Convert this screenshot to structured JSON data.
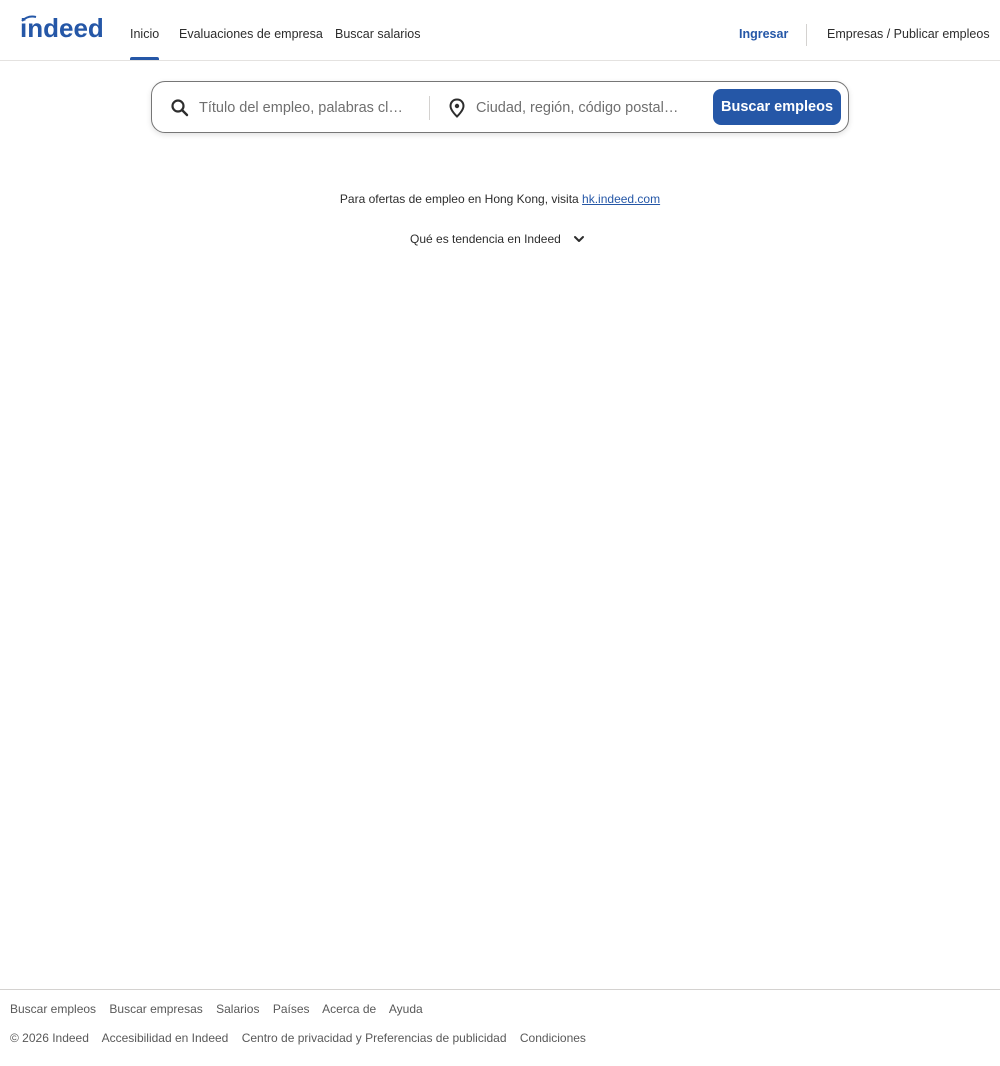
{
  "header": {
    "logo_text": "indeed",
    "nav": [
      "Inicio",
      "Evaluaciones de empresa",
      "Buscar salarios"
    ],
    "signin": "Ingresar",
    "employers": "Empresas / Publicar empleos"
  },
  "search": {
    "what_placeholder": "Título del empleo, palabras cl…",
    "where_placeholder": "Ciudad, región, código postal…",
    "button": "Buscar empleos"
  },
  "notice": {
    "text": "Para ofertas de empleo en Hong Kong, visita",
    "link": "hk.indeed.com",
    "trending": "Qué es tendencia en Indeed"
  },
  "footer": {
    "row1": [
      "Buscar empleos",
      "Buscar empresas",
      "Salarios",
      "Países",
      "Acerca de",
      "Ayuda"
    ],
    "copyright": "© 2026 Indeed",
    "row2": [
      "Accesibilidad en Indeed",
      "Centro de privacidad y Preferencias de publicidad",
      "Condiciones"
    ]
  },
  "colors": {
    "brand": "#2557a7",
    "text": "#2d2d2d"
  },
  "icons": [
    "indeed-logo",
    "search-icon",
    "location-pin-icon",
    "chevron-down-icon"
  ]
}
